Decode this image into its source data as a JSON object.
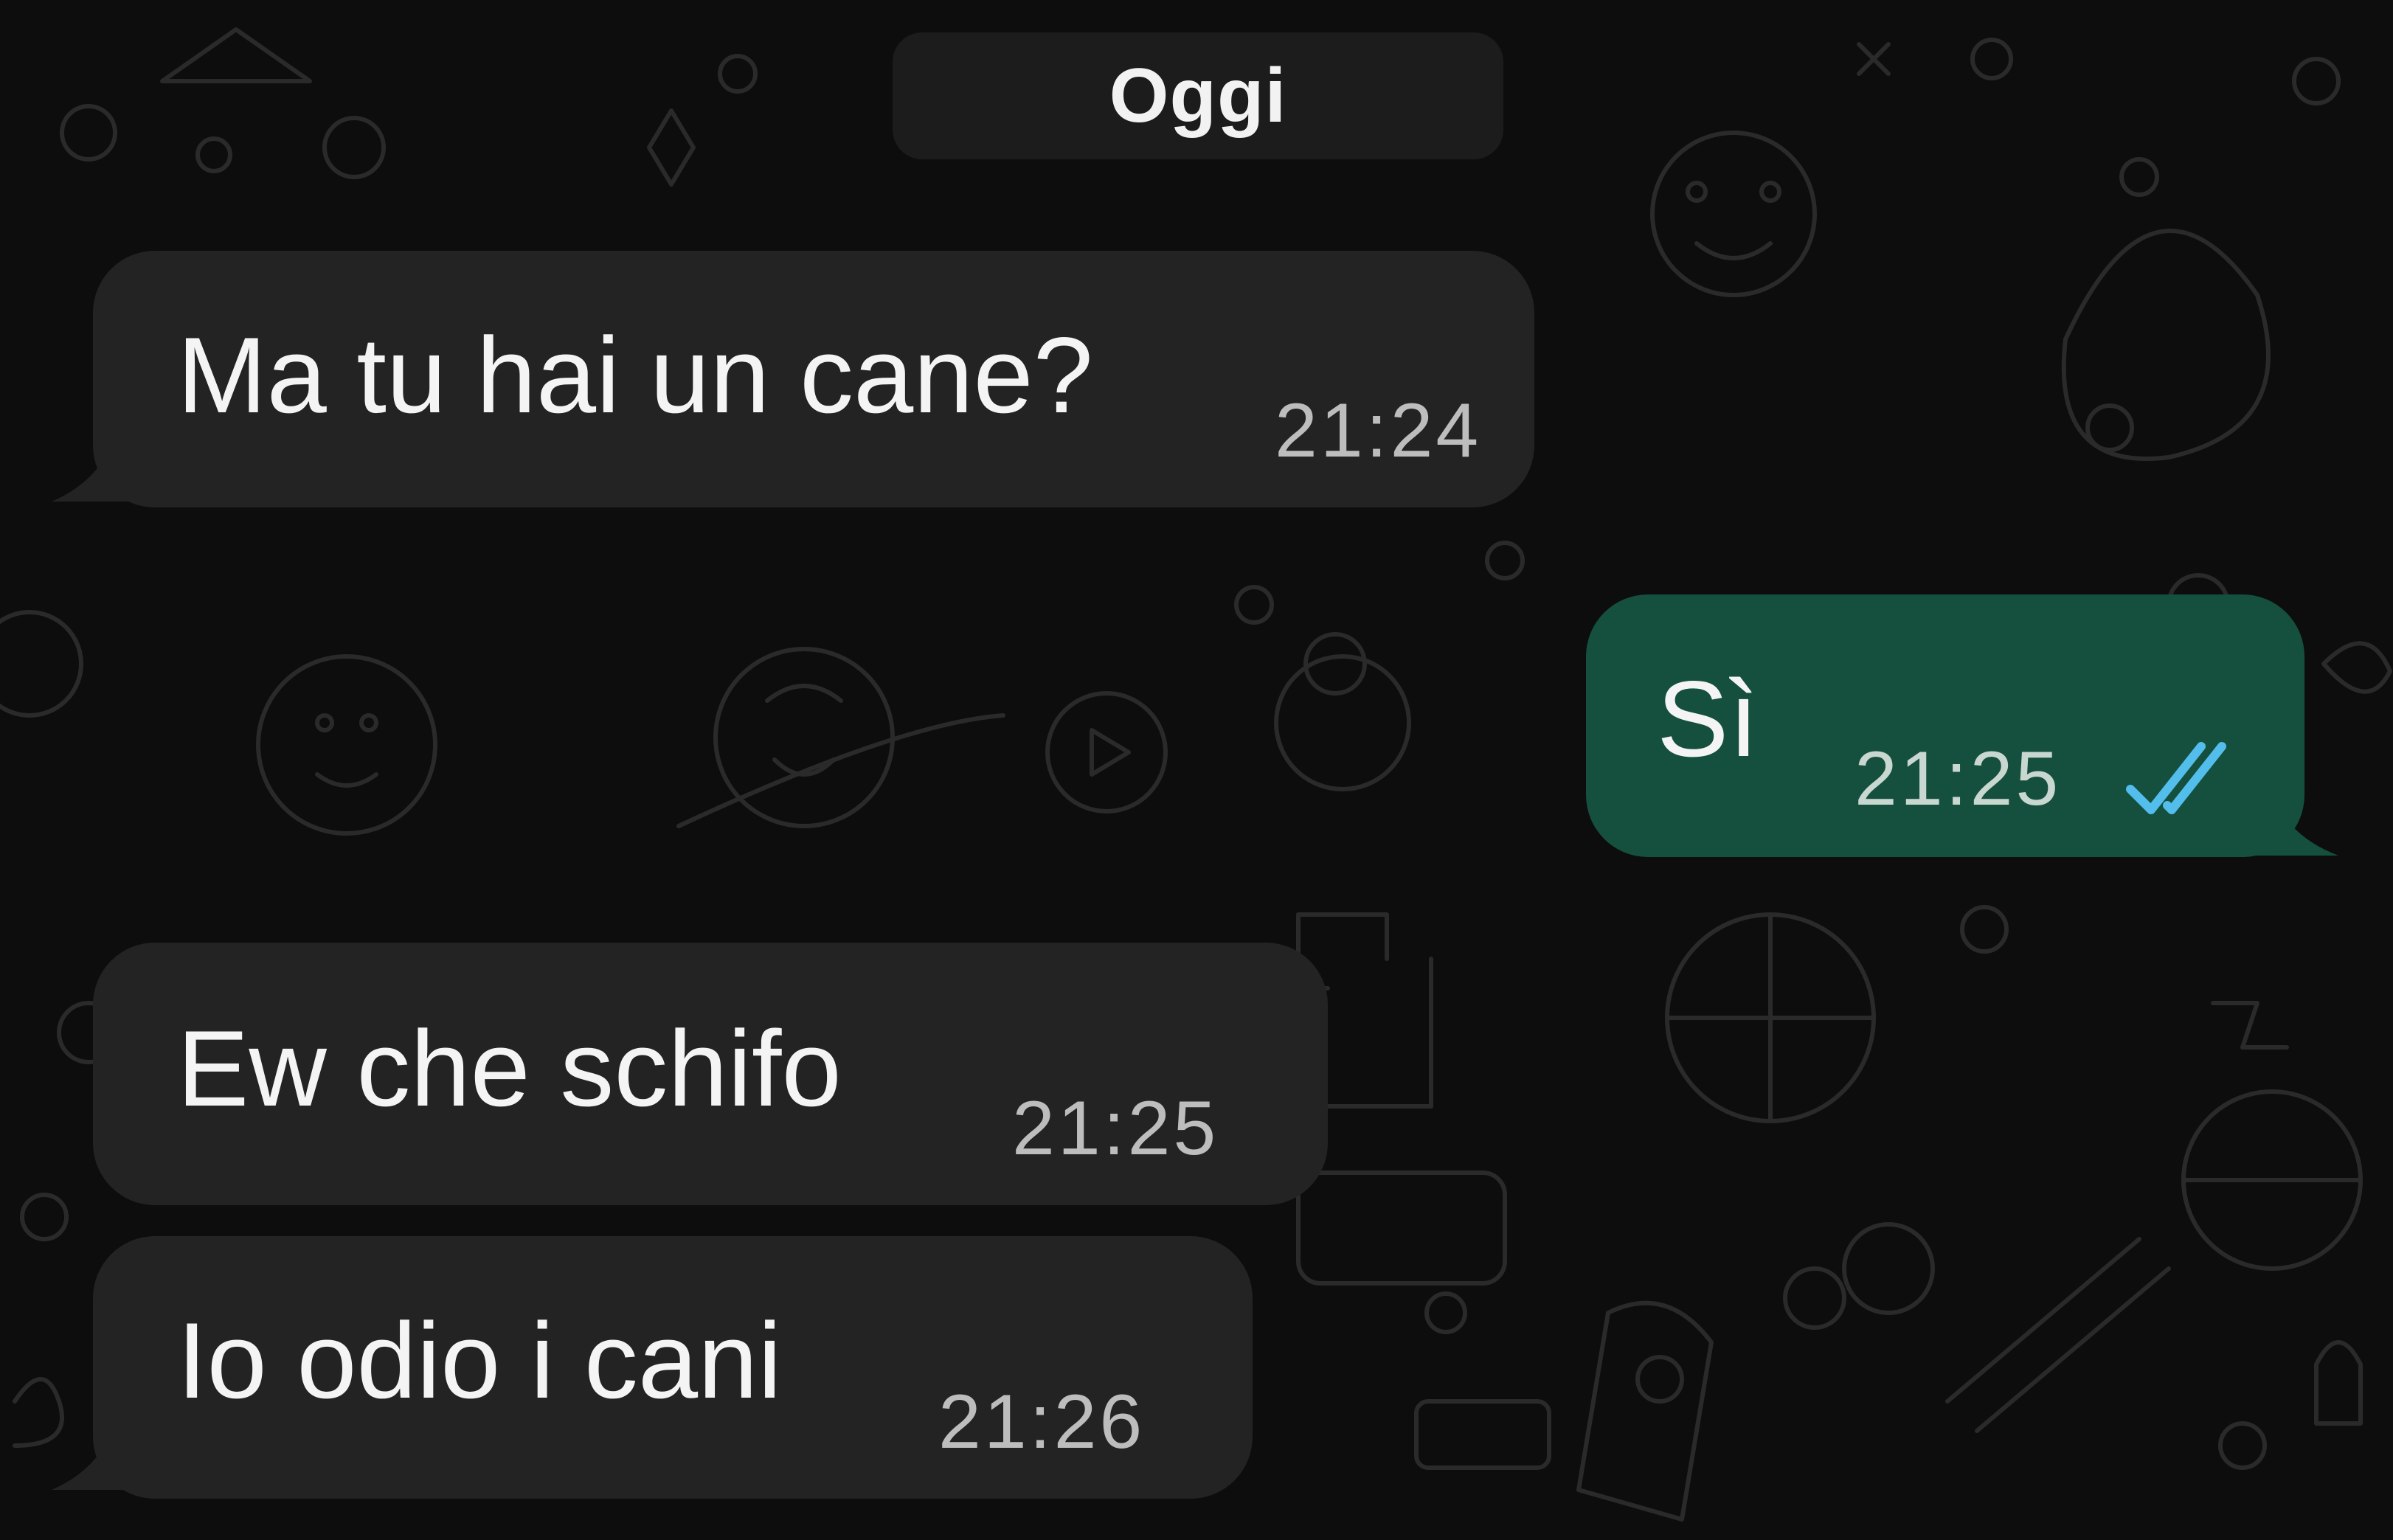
{
  "date_separator": "Oggi",
  "messages": [
    {
      "direction": "incoming",
      "text": "Ma tu hai un cane?",
      "time": "21:24"
    },
    {
      "direction": "outgoing",
      "text": "Sì",
      "time": "21:25",
      "status_icon": "double-check-read-icon"
    },
    {
      "direction": "incoming",
      "text": "Ew che schifo",
      "time": "21:25"
    },
    {
      "direction": "incoming",
      "text": "Io odio i cani",
      "time": "21:26"
    }
  ],
  "colors": {
    "background": "#0d0d0d",
    "incoming_bubble": "#232323",
    "outgoing_bubble": "#15503e",
    "read_ticks": "#53bdeb",
    "date_pill": "#1c1c1c"
  }
}
